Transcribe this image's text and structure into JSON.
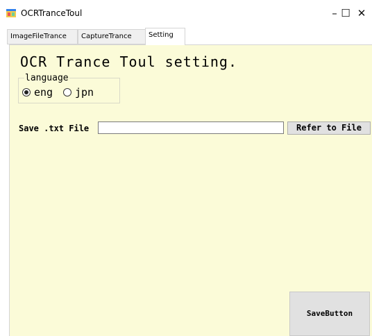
{
  "window": {
    "title": "OCRTranceToul",
    "controls": {
      "minimize": "–",
      "maximize": "☐",
      "close": "✕"
    }
  },
  "tabs": [
    {
      "label": "ImageFileTrance",
      "active": false
    },
    {
      "label": "CaptureTrance",
      "active": false
    },
    {
      "label": "Setting",
      "active": true
    }
  ],
  "settings": {
    "heading": "OCR Trance Toul setting.",
    "language_legend": "language",
    "options": [
      {
        "label": "eng",
        "checked": true
      },
      {
        "label": "jpn",
        "checked": false
      }
    ],
    "save_txt_label": "Save .txt File",
    "save_path_value": "",
    "refer_button": "Refer to File",
    "save_button": "SaveButton"
  },
  "colors": {
    "panel_bg": "#fbfbd8",
    "button_bg": "#e1e1e1"
  }
}
